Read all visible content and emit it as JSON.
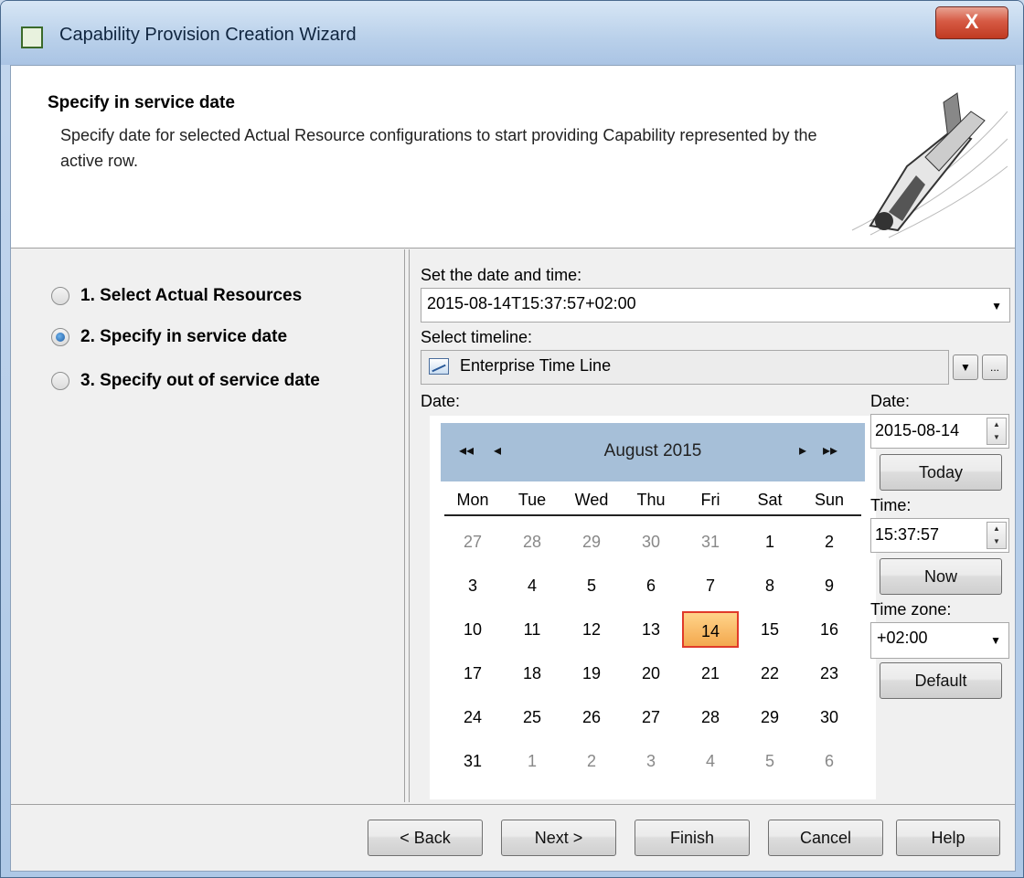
{
  "window": {
    "title": "Capability Provision Creation Wizard",
    "close_label": "X"
  },
  "header": {
    "title": "Specify in service date",
    "description": "Specify date for selected Actual Resource configurations to start providing Capability represented by the active row."
  },
  "steps": [
    {
      "label": "1. Select Actual Resources",
      "checked": false
    },
    {
      "label": "2. Specify in service date",
      "checked": true
    },
    {
      "label": "3. Specify out of service date",
      "checked": false
    }
  ],
  "form": {
    "datetime_label": "Set the date and time:",
    "datetime_value": "2015-08-14T15:37:57+02:00",
    "timeline_label": "Select timeline:",
    "timeline_value": "Enterprise Time Line",
    "ellipsis_label": "...",
    "date_label_left": "Date:",
    "date_label_right": "Date:",
    "date_value": "2015-08-14",
    "today_button": "Today",
    "time_label": "Time:",
    "time_value": "15:37:57",
    "now_button": "Now",
    "timezone_label": "Time zone:",
    "timezone_value": "+02:00",
    "default_button": "Default"
  },
  "calendar": {
    "month_label": "August  2015",
    "prev_year": "◂◂",
    "prev_month": "◂",
    "next_month": "▸",
    "next_year": "▸▸",
    "weekdays": [
      "Mon",
      "Tue",
      "Wed",
      "Thu",
      "Fri",
      "Sat",
      "Sun"
    ],
    "weeks": [
      [
        "27",
        "28",
        "29",
        "30",
        "31",
        "1",
        "2"
      ],
      [
        "3",
        "4",
        "5",
        "6",
        "7",
        "8",
        "9"
      ],
      [
        "10",
        "11",
        "12",
        "13",
        "14",
        "15",
        "16"
      ],
      [
        "17",
        "18",
        "19",
        "20",
        "21",
        "22",
        "23"
      ],
      [
        "24",
        "25",
        "26",
        "27",
        "28",
        "29",
        "30"
      ],
      [
        "31",
        "1",
        "2",
        "3",
        "4",
        "5",
        "6"
      ]
    ],
    "selected_day": "14",
    "accent_color": "#e03a2a"
  },
  "footer": {
    "back": "< Back",
    "next": "Next >",
    "finish": "Finish",
    "cancel": "Cancel",
    "help": "Help"
  }
}
